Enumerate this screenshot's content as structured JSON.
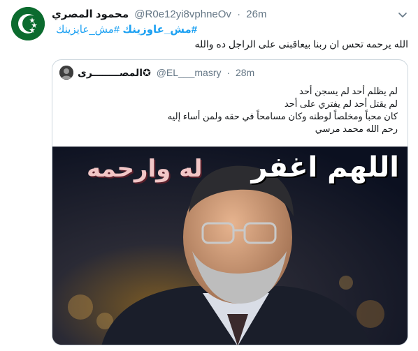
{
  "tweet": {
    "author_name": "محمود المصري",
    "author_handle": "@R0e12yi8vphneOv",
    "separator": "·",
    "time": "26m",
    "hashtag_primary": "#مش_عاوزينك",
    "hashtag_secondary": "#مش_عايزينك",
    "text": "الله يرحمه تحس ان ربنا بيعاقبنى على الراجل ده والله"
  },
  "quoted": {
    "author_name": "المصــــــــرى✪",
    "author_handle": "@EL___masry",
    "separator": "·",
    "time": "28m",
    "lines": [
      "لم يظلم أحد لم يسجن أحد",
      "لم يقتل أحد لم يفتري على أحد",
      "كان محباً ومخلصاً لوطنه وكان مسامحاً في حقه ولمن أساء إليه",
      "رحم الله محمد مرسي"
    ],
    "image_caption_1": "اللهم اغفر",
    "image_caption_2": "له وارحمه"
  },
  "icons": {
    "avatar": "green-crescent-stars-flag-avatar",
    "menu": "chevron-down-icon",
    "quoted_avatar": "user-avatar-icon"
  },
  "colors": {
    "link": "#1da1f2",
    "secondary_text": "#657786",
    "border": "#ccd6dd",
    "avatar_green": "#0b6b2e"
  }
}
